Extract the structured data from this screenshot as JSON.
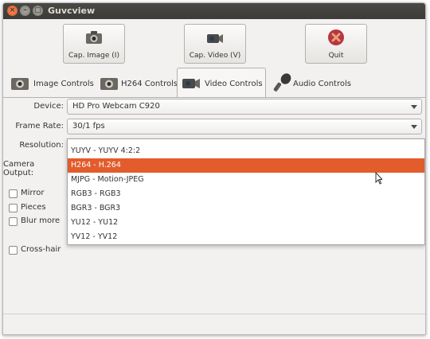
{
  "window": {
    "title": "Guvcview"
  },
  "toolbar": {
    "cap_image": "Cap. Image (I)",
    "cap_video": "Cap. Video (V)",
    "quit": "Quit"
  },
  "tabs": [
    {
      "label": "Image Controls",
      "icon": "camera-icon"
    },
    {
      "label": "H264 Controls",
      "icon": "camera-icon"
    },
    {
      "label": "Video Controls",
      "icon": "video-camera-icon"
    },
    {
      "label": "Audio Controls",
      "icon": "microphone-icon"
    }
  ],
  "form": {
    "device_label": "Device:",
    "device_value": "HD Pro Webcam C920",
    "frame_rate_label": "Frame Rate:",
    "frame_rate_value": "30/1 fps",
    "resolution_label": "Resolution:",
    "camera_output_label": "Camera Output:"
  },
  "dropdown": {
    "options": [
      "YUYV - YUYV 4:2:2",
      "H264 - H.264",
      "MJPG - Motion-JPEG",
      "RGB3 - RGB3",
      "BGR3 - BGR3",
      "YU12 - YU12",
      "YV12 - YV12"
    ],
    "selected": "H264 - H.264"
  },
  "filters": {
    "mirror": "Mirror",
    "pieces": "Pieces",
    "blur_more": "Blur more",
    "cross_hair": "Cross-hair"
  },
  "colors": {
    "accent": "#e25c2c",
    "titlebar": "#3c3b37"
  }
}
